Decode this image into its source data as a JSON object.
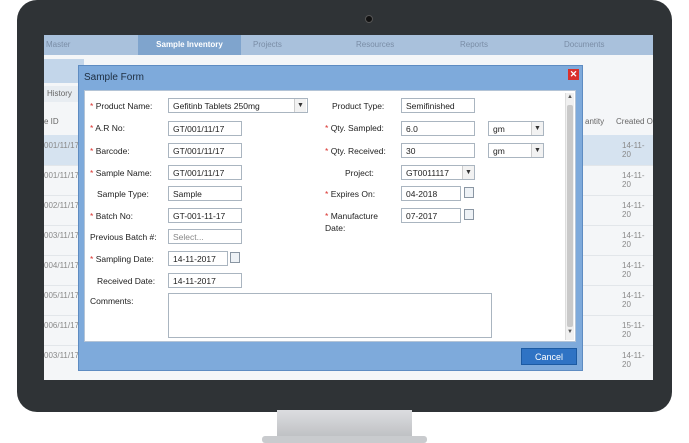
{
  "nav": {
    "items": [
      "Master",
      "Sample Inventory",
      "Projects",
      "Resources",
      "Reports",
      "Documents"
    ]
  },
  "history_tab": "History",
  "grid": {
    "left_header": "e ID",
    "right_headers": [
      "antity",
      "Created O"
    ],
    "left_cells": [
      "001/11/17",
      "001/11/17",
      "002/11/17",
      "003/11/17",
      "004/11/17",
      "005/11/17",
      "006/11/17",
      "003/11/17"
    ],
    "right_cells": [
      "14-11-20",
      "14-11-20",
      "14-11-20",
      "14-11-20",
      "14-11-20",
      "14-11-20",
      "15-11-20",
      "14-11-20"
    ]
  },
  "modal": {
    "title": "Sample Form",
    "close_icon": "close-icon",
    "cancel_label": "Cancel"
  },
  "form": {
    "product_name": {
      "label": "Product Name:",
      "value": "Gefitinb Tablets 250mg"
    },
    "ar_no": {
      "label": "A.R No:",
      "value": "GT/001/11/17"
    },
    "barcode": {
      "label": "Barcode:",
      "value": "GT/001/11/17"
    },
    "sample_name": {
      "label": "Sample Name:",
      "value": "GT/001/11/17"
    },
    "sample_type": {
      "label": "Sample Type:",
      "value": "Sample"
    },
    "batch_no": {
      "label": "Batch No:",
      "value": "GT-001-11-17"
    },
    "previous_batch": {
      "label": "Previous Batch #:",
      "placeholder": "Select..."
    },
    "sampling_date": {
      "label": "Sampling Date:",
      "value": "14-11-2017"
    },
    "received_date": {
      "label": "Received Date:",
      "value": "14-11-2017"
    },
    "comments": {
      "label": "Comments:"
    },
    "product_type": {
      "label": "Product Type:",
      "value": "Semifinished"
    },
    "qty_sampled": {
      "label": "Qty. Sampled:",
      "value": "6.0",
      "unit": "gm"
    },
    "qty_received": {
      "label": "Qty. Received:",
      "value": "30",
      "unit": "gm"
    },
    "project": {
      "label": "Project:",
      "value": "GT0011117"
    },
    "expires_on": {
      "label": "Expires On:",
      "value": "04-2018"
    },
    "manufacture_date": {
      "label": "Manufacture",
      "label2": "Date:",
      "value": "07-2017"
    }
  },
  "required_marker": "*",
  "colors": {
    "accent": "#2f73c4",
    "modal": "#7eaadb",
    "close": "#d9302c"
  }
}
